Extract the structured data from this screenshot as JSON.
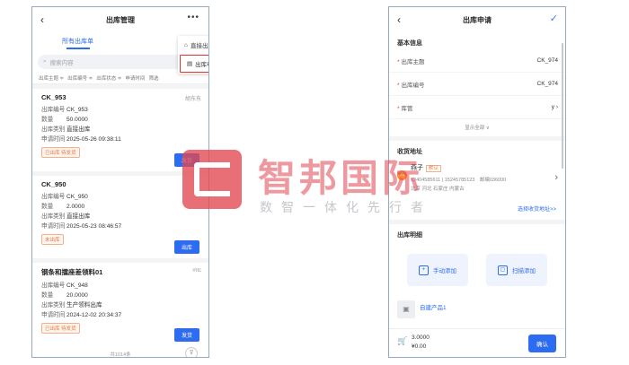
{
  "left": {
    "nav": {
      "back_icon": "‹",
      "title": "出库管理",
      "more_icon": "•••"
    },
    "tab_all": "所有出库单",
    "dropdown": {
      "direct": "直接出库",
      "apply": "出库申请"
    },
    "search_placeholder": "搜索内容",
    "columns": [
      "出库主题 ≑",
      "出库编号 ≑",
      "出库状态 ≑",
      "申请时间",
      "筛选"
    ],
    "cards": [
      {
        "title": "CK_953",
        "right": "胡东东",
        "fields": [
          {
            "k": "出库编号",
            "v": "CK_953"
          },
          {
            "k": "数量",
            "v": "50.0000"
          },
          {
            "k": "出库类别",
            "v": "直接出库"
          },
          {
            "k": "申请时间",
            "v": "2025-05-26 09:38:11"
          }
        ],
        "badge": "已出库 待发货",
        "button": "发货"
      },
      {
        "title": "CK_950",
        "right": "",
        "fields": [
          {
            "k": "出库编号",
            "v": "CK_950"
          },
          {
            "k": "数量",
            "v": "2.0000"
          },
          {
            "k": "出库类别",
            "v": "直接出库"
          },
          {
            "k": "申请时间",
            "v": "2025-05-23 08:46:57"
          }
        ],
        "badge": "未出库",
        "button": "出库"
      },
      {
        "title": "钢条和擂座差领料01",
        "right": "mtc",
        "fields": [
          {
            "k": "出库编号",
            "v": "CK_948"
          },
          {
            "k": "数量",
            "v": "20.0000"
          },
          {
            "k": "出库类别",
            "v": "生产领料出库"
          },
          {
            "k": "申请时间",
            "v": "2024-12-02 20:34:37"
          }
        ],
        "badge": "已出库 待发货",
        "button": "发货"
      }
    ],
    "footer_count": "共1014条"
  },
  "right": {
    "nav": {
      "back_icon": "‹",
      "title": "出库申请",
      "check_icon": "✓"
    },
    "basic_title": "基本信息",
    "fields": [
      {
        "label": "出库主题",
        "value": "CK_974"
      },
      {
        "label": "出库编号",
        "value": "CK_974"
      },
      {
        "label": "库管",
        "value": "y ›"
      }
    ],
    "show_all": "显示全部 ∨",
    "address_title": "收货地址",
    "address": {
      "avatar": "A",
      "name": "燕子",
      "tag": "默认",
      "phones": "13404585611 | 15245785123　邮编036000",
      "location": "北京 河北 石家庄 内蒙古"
    },
    "choose_address": "选择收货地址>>",
    "detail_title": "出库明细",
    "manual_add": "手动添加",
    "scan_add": "扫描添加",
    "product_name": "自建产品1",
    "bottom": {
      "qty": "3.0000",
      "amount": "¥0.00",
      "confirm": "确认"
    }
  },
  "watermark": {
    "title": "智邦国际",
    "subtitle": "数智一体化先行者"
  },
  "colors": {
    "accent": "#2d6cf0",
    "highlight": "#e0342f",
    "badge": "#e2783d"
  }
}
